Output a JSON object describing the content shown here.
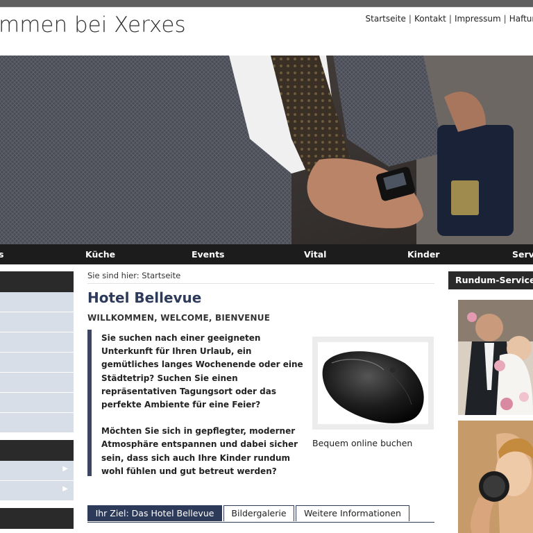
{
  "header": {
    "site_title": "mmen bei Xerxes",
    "meta_nav": [
      "Startseite",
      "Kontakt",
      "Impressum",
      "Haftun"
    ]
  },
  "main_nav": [
    "s",
    "Küche",
    "Events",
    "Vital",
    "Kinder",
    "Serv"
  ],
  "breadcrumb": "Sie sind hier: Startseite",
  "content": {
    "title": "Hotel Bellevue",
    "subtitle": "WILLKOMMEN, WELCOME, BIENVENUE",
    "intro_p1": "Sie suchen nach einer geeigneten Unterkunft für Ihren Urlaub, ein gemütliches langes Wochenende oder eine Städtetrip? Suchen Sie einen repräsentativen Tagungsort oder das perfekte Ambiente für eine Feier?",
    "intro_p2": "Möchten Sie sich in gepflegter, moderner Atmosphäre entspannen und dabei sicher sein, dass sich auch Ihre Kinder rundum wohl fühlen und gut betreut werden?",
    "image_caption": "Bequem online buchen"
  },
  "tabs": [
    "Ihr Ziel: Das Hotel Bellevue",
    "Bildergalerie",
    "Weitere Informationen"
  ],
  "right_sidebar": {
    "heading": "Rundum-Service"
  },
  "colors": {
    "accent_navy": "#2d3a59",
    "nav_bg": "#1c1c1c",
    "sidebar_item": "#d7dee8"
  }
}
